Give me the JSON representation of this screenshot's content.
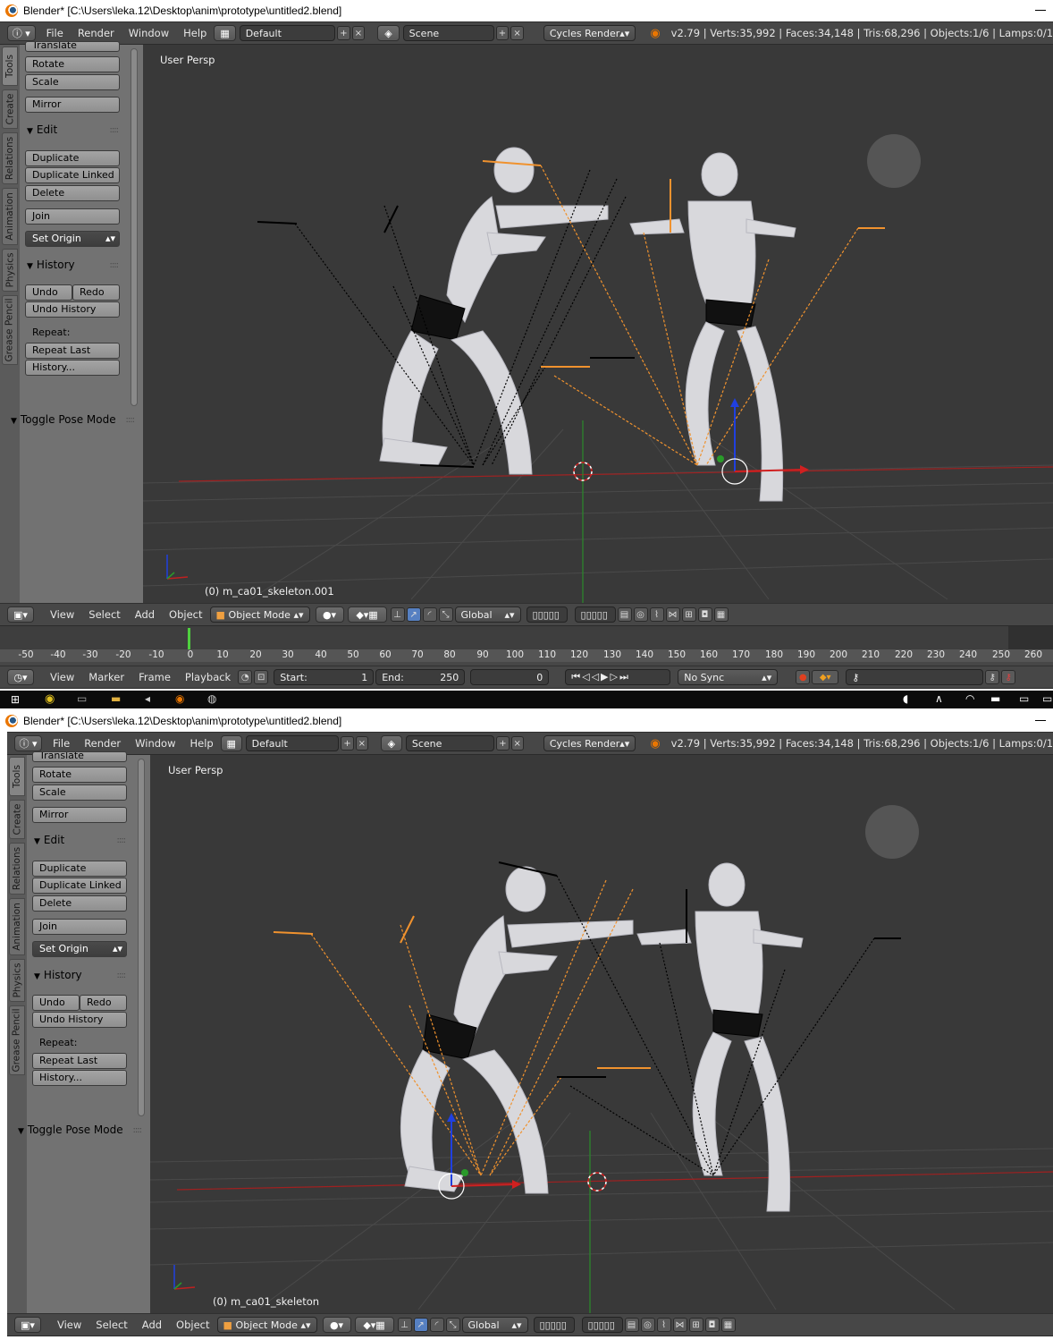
{
  "window": {
    "title": "Blender* [C:\\Users\\leka.12\\Desktop\\anim\\prototype\\untitled2.blend]"
  },
  "info_header": {
    "menus": [
      "File",
      "Render",
      "Window",
      "Help"
    ],
    "layout": "Default",
    "scene": "Scene",
    "engine": "Cycles Render",
    "stats": "v2.79 | Verts:35,992 | Faces:34,148 | Tris:68,296 | Objects:1/6 | Lamps:0/1"
  },
  "toolshelf": {
    "tabs": [
      "Tools",
      "Create",
      "Relations",
      "Animation",
      "Physics",
      "Grease Pencil"
    ],
    "transform_buttons": [
      "Translate",
      "Rotate",
      "Scale"
    ],
    "mirror": "Mirror",
    "edit_title": "Edit",
    "edit_buttons": [
      "Duplicate",
      "Duplicate Linked",
      "Delete"
    ],
    "join": "Join",
    "set_origin": "Set Origin",
    "history_title": "History",
    "undo": "Undo",
    "redo": "Redo",
    "undo_history": "Undo History",
    "repeat_label": "Repeat:",
    "repeat_last": "Repeat Last",
    "history_btn": "History...",
    "toggle_pose": "Toggle Pose Mode"
  },
  "viewport1": {
    "view_label": "User Persp",
    "object_label": "(0) m_ca01_skeleton.001"
  },
  "viewport2": {
    "view_label": "User Persp",
    "object_label": "(0) m_ca01_skeleton"
  },
  "view3d_header": {
    "menus": [
      "View",
      "Select",
      "Add",
      "Object"
    ],
    "mode": "Object Mode",
    "orientation": "Global"
  },
  "timeline": {
    "ruler": [
      "-50",
      "-40",
      "-30",
      "-20",
      "-10",
      "0",
      "10",
      "20",
      "30",
      "40",
      "50",
      "60",
      "70",
      "80",
      "90",
      "100",
      "110",
      "120",
      "130",
      "140",
      "150",
      "160",
      "170",
      "180",
      "190",
      "200",
      "210",
      "220",
      "230",
      "240",
      "250",
      "260"
    ],
    "menus": [
      "View",
      "Marker",
      "Frame",
      "Playback"
    ],
    "start_label": "Start:",
    "start_value": "1",
    "end_label": "End:",
    "end_value": "250",
    "current_frame": "0",
    "sync": "No Sync"
  },
  "colors": {
    "viewport_bg": "#393939",
    "header_bg": "#474747",
    "toolshelf_bg": "#727272",
    "selected_bones": "#f0922e",
    "unselected_bones": "#000000",
    "x_axis": "#c02020",
    "y_axis": "#2a9a2a",
    "z_axis": "#2040e0"
  }
}
